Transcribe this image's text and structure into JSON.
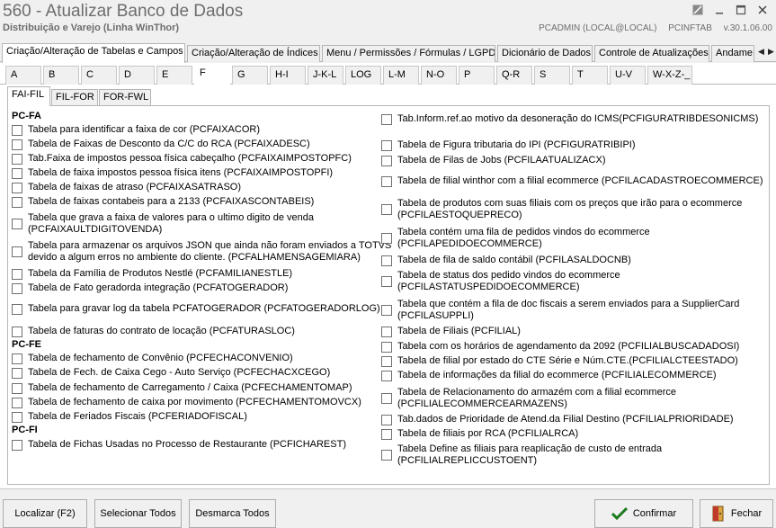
{
  "window": {
    "title": "560 - Atualizar Banco de Dados",
    "subtitle": "Distribuição e Varejo (Linha WinThor)",
    "user": "PCADMIN (LOCAL@LOCAL)",
    "app_name": "PCINFTAB",
    "version": "v.30.1.06.00"
  },
  "top_tabs": [
    "Criação/Alteração de Tabelas e Campos",
    "Criação/Alteração de Índices",
    "Menu / Permissões / Fórmulas / LGPD",
    "Dicionário de Dados",
    "Controle de Atualizações",
    "Andame"
  ],
  "letter_tabs": [
    "A",
    "B",
    "C",
    "D",
    "E",
    "F",
    "G",
    "H-I",
    "J-K-L",
    "LOG",
    "L-M",
    "N-O",
    "P",
    "Q-R",
    "S",
    "T",
    "U-V",
    "W-X-Z-_"
  ],
  "sub_tabs": [
    "FAI-FIL",
    "FIL-FOR",
    "FOR-FWL"
  ],
  "left": {
    "group_fa": "PC-FA",
    "fa": [
      "Tabela para identificar a faixa de cor (PCFAIXACOR)",
      "Tabela de Faixas de Desconto da C/C do RCA (PCFAIXADESC)",
      "Tab.Faixa de impostos pessoa física cabeçalho (PCFAIXAIMPOSTOPFC)",
      "Tabela de faixa impostos pessoa física itens (PCFAIXAIMPOSTOPFI)",
      "Tabela de faixas de atraso (PCFAIXASATRASO)",
      "Tabela de faixas contabeis para a 2133 (PCFAIXASCONTABEIS)",
      "Tabela que grava a faixa de valores para o ultimo digito de venda\n(PCFAIXAULTDIGITOVENDA)",
      "Tabela para armazenar os arquivos JSON que ainda não foram enviados a TOTVS\ndevido a algum erros no ambiente do cliente. (PCFALHAMENSAGEMIARA)",
      "Tabela da Família de Produtos Nestlé (PCFAMILIANESTLE)",
      "Tabela de Fato geradorda integração (PCFATOGERADOR)",
      "Tabela para gravar log da tabela PCFATOGERADOR (PCFATOGERADORLOG)",
      "Tabela de faturas do contrato de locação (PCFATURASLOC)"
    ],
    "group_fe": "PC-FE",
    "fe": [
      "Tabela de fechamento de Convênio (PCFECHACONVENIO)",
      "Tabela de Fech. de Caixa Cego - Auto Serviço (PCFECHACXCEGO)",
      "Tabela de fechamento de Carregamento / Caixa (PCFECHAMENTOMAP)",
      "Tabela de fechamento de caixa por movimento (PCFECHAMENTOMOVCX)",
      "Tabela de Feriados Fiscais (PCFERIADOFISCAL)"
    ],
    "group_fi": "PC-FI",
    "fi": [
      "Tabela de Fichas Usadas no Processo de Restaurante (PCFICHAREST)"
    ]
  },
  "right": [
    "Tab.Inform.ref.ao motivo da desoneração do ICMS(PCFIGURATRIBDESONICMS)",
    "Tabela de Figura tributaria do IPI (PCFIGURATRIBIPI)",
    "Tabela de Filas de Jobs (PCFILAATUALIZACX)",
    "Tabela de filial winthor com a filial ecommerce (PCFILACADASTROECOMMERCE)",
    "Tabela de produtos com suas filiais com os preços que irão para o ecommerce\n(PCFILAESTOQUEPRECO)",
    "Tabela contém uma fila de pedidos vindos do ecommerce\n(PCFILAPEDIDOECOMMERCE)",
    "Tabela de fila de saldo contábil (PCFILASALDOCNB)",
    "Tabela de status dos pedido vindos do ecommerce\n(PCFILASTATUSPEDIDOECOMMERCE)",
    "Tabela que contém a fila de doc fiscais a serem enviados para a SupplierCard\n(PCFILASUPPLI)",
    "Tabela de Filiais (PCFILIAL)",
    "Tabela com os horários de agendamento da 2092 (PCFILIALBUSCADADOSI)",
    "Tabela de filial por estado do CTE Série e Núm.CTE.(PCFILIALCTEESTADO)",
    "Tabela de informações da filial do ecommerce (PCFILIALECOMMERCE)",
    "Tabela de Relacionamento do armazém com a filial ecommerce\n(PCFILIALECOMMERCEARMAZENS)",
    "Tab.dados de Prioridade de Atend.da Filial Destino (PCFILIALPRIORIDADE)",
    "Tabela de filiais por RCA (PCFILIALRCA)",
    "Tabela Define as filiais para reaplicação de custo de entrada\n(PCFILIALREPLICCUSTOENT)"
  ],
  "buttons": {
    "localizar": "Localizar (F2)",
    "selecionar": "Selecionar Todos",
    "desmarca": "Desmarca Todos",
    "confirmar": "Confirmar",
    "fechar": "Fechar"
  },
  "icons": {
    "confirm": "check-icon",
    "close": "exit-door-icon"
  },
  "colors": {
    "title_gray": "#6d6d6d",
    "confirm_green": "#1a7a1a",
    "exit_red": "#c0392b"
  }
}
